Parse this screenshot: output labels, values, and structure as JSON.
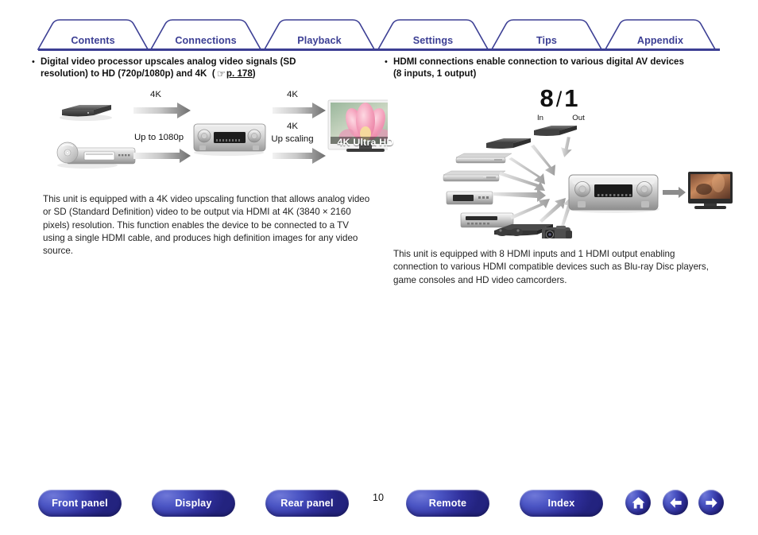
{
  "tabs": [
    {
      "label": "Contents",
      "name": "tab-contents"
    },
    {
      "label": "Connections",
      "name": "tab-connections"
    },
    {
      "label": "Playback",
      "name": "tab-playback"
    },
    {
      "label": "Settings",
      "name": "tab-settings"
    },
    {
      "label": "Tips",
      "name": "tab-tips"
    },
    {
      "label": "Appendix",
      "name": "tab-appendix"
    }
  ],
  "left": {
    "bullet": "Digital video processor upscales analog video signals (SD resolution) to HD (720p/1080p) and 4K",
    "link_open": "(",
    "link_page": "p. 178",
    "link_close": ")",
    "diagram": {
      "label_top_left": "4K",
      "label_bottom_left": "Up to 1080p",
      "label_top_right": "4K",
      "label_bottom_right_1": "4K",
      "label_bottom_right_2": "Up scaling",
      "tv_caption": "4K Ultra HD"
    },
    "paragraph": "This unit is equipped with a 4K video upscaling function that allows analog video or SD (Standard Definition) video to be output via HDMI at 4K (3840 × 2160 pixels) resolution. This function enables the device to be connected to a TV using a single HDMI cable, and produces high definition images for any video source."
  },
  "right": {
    "bullet": "HDMI connections enable connection to various digital AV devices (8 inputs, 1 output)",
    "ratio": {
      "inputs": "8",
      "slash": "/",
      "outputs": "1",
      "in_label": "In",
      "out_label": "Out"
    },
    "paragraph": "This unit is equipped with 8 HDMI inputs and 1 HDMI output enabling connection to various HDMI compatible devices such as Blu-ray Disc players, game consoles and HD video camcorders."
  },
  "bottom": {
    "page_number": "10",
    "buttons": [
      {
        "label": "Front panel",
        "name": "front-panel-button"
      },
      {
        "label": "Display",
        "name": "display-button"
      },
      {
        "label": "Rear panel",
        "name": "rear-panel-button"
      },
      {
        "label": "Remote",
        "name": "remote-button"
      },
      {
        "label": "Index",
        "name": "index-button"
      }
    ]
  },
  "colors": {
    "tab_blue": "#3c3f94",
    "button_blue": "#2f2f9b",
    "text": "#111111"
  }
}
